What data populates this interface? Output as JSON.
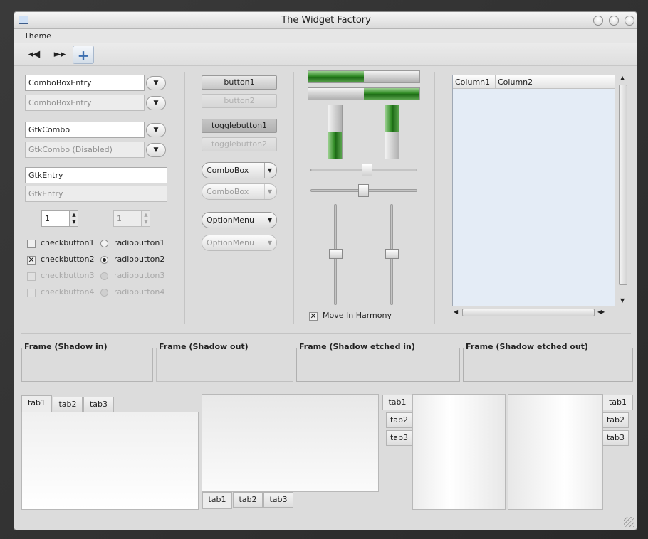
{
  "window": {
    "title": "The Widget Factory"
  },
  "menu": {
    "theme": "Theme"
  },
  "toolbar": {
    "back_icon": "◂◀",
    "forward_icon": "►▸",
    "add_icon": "+"
  },
  "combos": {
    "combo_entry": "ComboBoxEntry",
    "combo_entry_disabled": "ComboBoxEntry",
    "gtk_combo": "GtkCombo",
    "gtk_combo_disabled": "GtkCombo (Disabled)",
    "entry": "GtkEntry",
    "entry_disabled": "GtkEntry",
    "spin_value": "1",
    "spin_disabled_value": "1"
  },
  "checks": [
    {
      "label": "checkbutton1",
      "checked": false,
      "disabled": false
    },
    {
      "label": "checkbutton2",
      "checked": true,
      "disabled": false
    },
    {
      "label": "checkbutton3",
      "checked": false,
      "disabled": true
    },
    {
      "label": "checkbutton4",
      "checked": false,
      "disabled": true
    }
  ],
  "radios": [
    {
      "label": "radiobutton1",
      "selected": false,
      "disabled": false
    },
    {
      "label": "radiobutton2",
      "selected": true,
      "disabled": false
    },
    {
      "label": "radiobutton3",
      "selected": false,
      "disabled": true
    },
    {
      "label": "radiobutton4",
      "selected": false,
      "disabled": true
    }
  ],
  "buttons": {
    "button1": "button1",
    "button2": "button2",
    "toggle1": "togglebutton1",
    "toggle2": "togglebutton2",
    "combobox": "ComboBox",
    "combobox_disabled": "ComboBox",
    "optionmenu": "OptionMenu",
    "optionmenu_disabled": "OptionMenu"
  },
  "progress": {
    "h1": 0.5,
    "h2": 0.5,
    "v1": 0.5,
    "v2": 0.5
  },
  "scales": {
    "h1": 0.5,
    "h2": 0.5,
    "v1": 0.5,
    "v2": 0.5
  },
  "harmony": {
    "label": "Move In Harmony",
    "checked": true
  },
  "tree": {
    "columns": [
      "Column1",
      "Column2"
    ]
  },
  "frames": [
    "Frame (Shadow in)",
    "Frame (Shadow out)",
    "Frame (Shadow etched in)",
    "Frame (Shadow etched out)"
  ],
  "notebooks": {
    "tabs": [
      "tab1",
      "tab2",
      "tab3"
    ]
  },
  "colors": {
    "window_bg": "#dcdcdc",
    "progress_green": "#2f8a24",
    "tree_bg": "#e4ecf6"
  }
}
